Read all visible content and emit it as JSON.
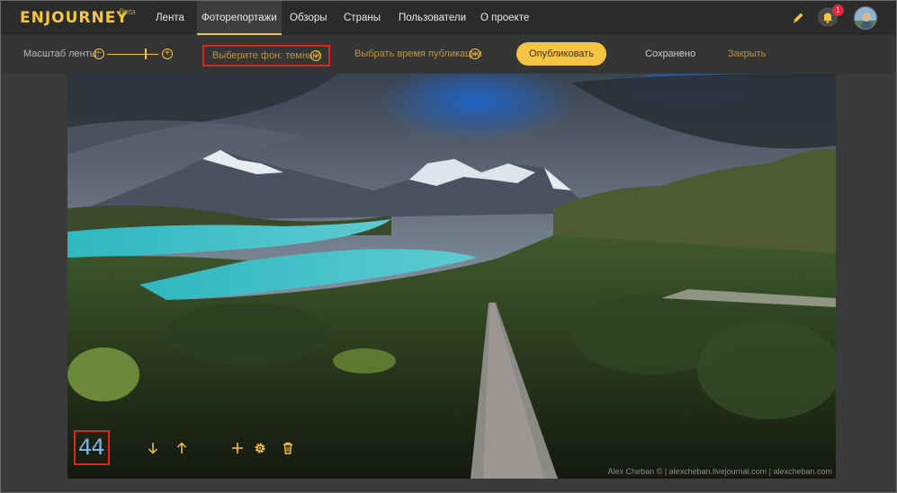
{
  "brand": {
    "logo": "ENJOURNEY",
    "beta": "Beta",
    "accent": "#f6c443"
  },
  "nav": {
    "items": [
      {
        "label": "Лента"
      },
      {
        "label": "Фоторепортажи",
        "active": true
      },
      {
        "label": "Обзоры"
      },
      {
        "label": "Страны"
      },
      {
        "label": "Пользователи"
      },
      {
        "label": "О проекте"
      }
    ],
    "notifications_count": "1",
    "icons": {
      "edit": "pencil-icon",
      "notifications": "bell-icon",
      "profile": "avatar"
    }
  },
  "toolbar": {
    "zoom_label": "Масштаб ленты:",
    "zoom_minus": "−",
    "zoom_plus": "+",
    "zoom_level": 0.76,
    "background_select": "Выберите фон: темный",
    "publish_time_select": "Выбрать время публикации",
    "publish_button": "Опубликовать",
    "saved_status": "Сохранено",
    "close_link": "Закрыть"
  },
  "photo": {
    "counter": "44",
    "credit": "Alex Cheban © | alexcheban.livejournal.com | alexcheban.com",
    "tools": [
      "arrow-down-icon",
      "arrow-up-icon",
      "plus-icon",
      "gear-icon",
      "trash-icon"
    ]
  },
  "colors": {
    "highlight": "#e0261b",
    "badge": "#e3283a",
    "counter": "#7fb3e6"
  }
}
